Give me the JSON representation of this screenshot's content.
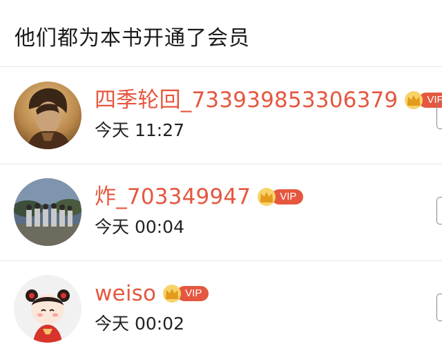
{
  "header": {
    "title": "他们都为本书开通了会员"
  },
  "members": [
    {
      "name": "四季轮回_733939853306379",
      "vip_label": "VIP",
      "time": "今天 11:27",
      "avatar_icon": "avatar-young-man-portrait"
    },
    {
      "name": "炸_703349947",
      "vip_label": "VIP",
      "time": "今天 00:04",
      "avatar_icon": "avatar-group-photo"
    },
    {
      "name": "weiso",
      "vip_label": "VIP",
      "time": "今天 00:02",
      "avatar_icon": "avatar-cartoon-girl"
    }
  ],
  "colors": {
    "accent": "#e5573f",
    "divider": "#e6e6e6",
    "crown": "#f3b53a"
  }
}
